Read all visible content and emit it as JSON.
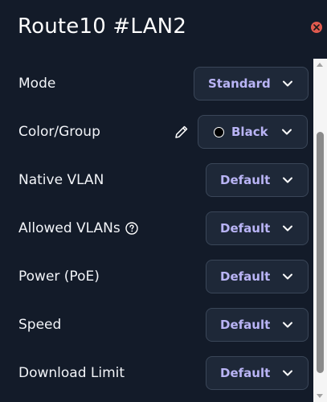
{
  "header": {
    "title": "Route10 #LAN2",
    "close_icon": "close-icon",
    "close_color": "#e05a4f"
  },
  "accent_color": "#b9b4f5",
  "settings": {
    "mode": {
      "label": "Mode",
      "value": "Standard"
    },
    "color_group": {
      "label": "Color/Group",
      "value": "Black",
      "edit_icon": "pencil-icon",
      "swatch_color": "#000000"
    },
    "native_vlan": {
      "label": "Native VLAN",
      "value": "Default"
    },
    "allowed_vlans": {
      "label": "Allowed VLANs",
      "value": "Default",
      "help_icon": "help-circle-icon"
    },
    "power": {
      "label": "Power (PoE)",
      "value": "Default"
    },
    "speed": {
      "label": "Speed",
      "value": "Default"
    },
    "download_limit": {
      "label": "Download Limit",
      "value": "Default"
    }
  }
}
